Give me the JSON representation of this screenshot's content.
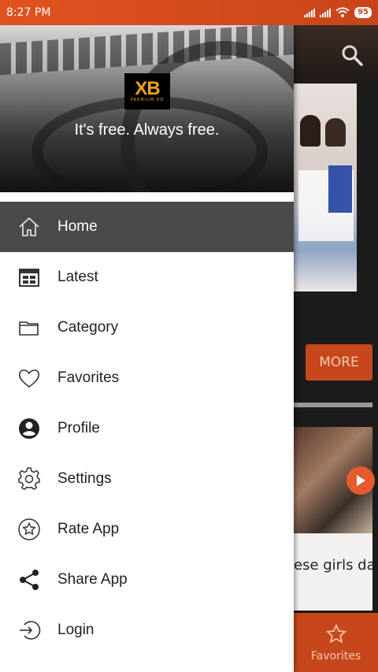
{
  "status_bar": {
    "time": "8:27 PM",
    "battery": "95"
  },
  "drawer": {
    "logo_text": "XB",
    "logo_subtext": "PREMIUM HD",
    "tagline": "It's free. Always free.",
    "items": [
      {
        "label": "Home",
        "icon": "home-icon",
        "active": true
      },
      {
        "label": "Latest",
        "icon": "calendar-icon",
        "active": false
      },
      {
        "label": "Category",
        "icon": "folder-icon",
        "active": false
      },
      {
        "label": "Favorites",
        "icon": "heart-icon",
        "active": false
      },
      {
        "label": "Profile",
        "icon": "account-icon",
        "active": false
      },
      {
        "label": "Settings",
        "icon": "gear-icon",
        "active": false
      },
      {
        "label": "Rate App",
        "icon": "star-circle-icon",
        "active": false
      },
      {
        "label": "Share App",
        "icon": "share-icon",
        "active": false
      },
      {
        "label": "Login",
        "icon": "login-icon",
        "active": false
      }
    ]
  },
  "background": {
    "more_button": "MORE",
    "caption_text": "ese girls da",
    "bottom_nav_label": "Favorites"
  },
  "colors": {
    "accent": "#c7471d",
    "status_bar": "#e0531f",
    "active_item": "#4a4a4a"
  }
}
